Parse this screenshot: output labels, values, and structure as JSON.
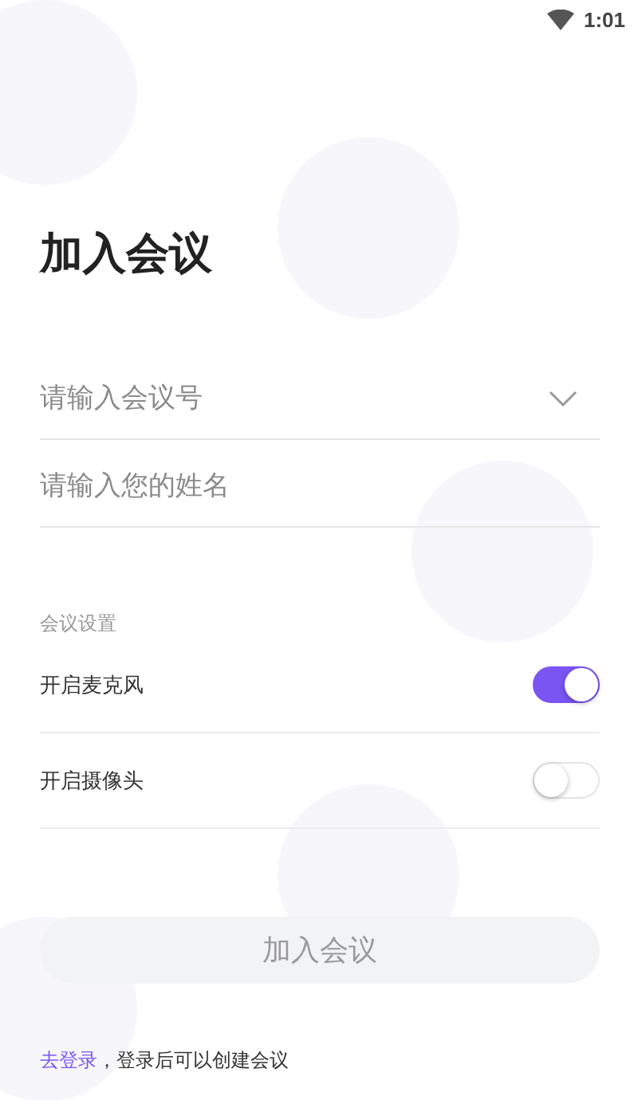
{
  "status_bar": {
    "time": "1:01"
  },
  "title": "加入会议",
  "fields": [
    {
      "placeholder": "请输入会议号",
      "kind": "dropdown"
    },
    {
      "placeholder": "请输入您的姓名",
      "kind": "text"
    }
  ],
  "settings": {
    "heading": "会议设置",
    "items": [
      {
        "label": "开启麦克风",
        "on": true
      },
      {
        "label": "开启摄像头",
        "on": false
      }
    ]
  },
  "join_button": {
    "label": "加入会议",
    "disabled": true
  },
  "footer": {
    "link": "去登录",
    "text": "，登录后可以创建会议"
  }
}
